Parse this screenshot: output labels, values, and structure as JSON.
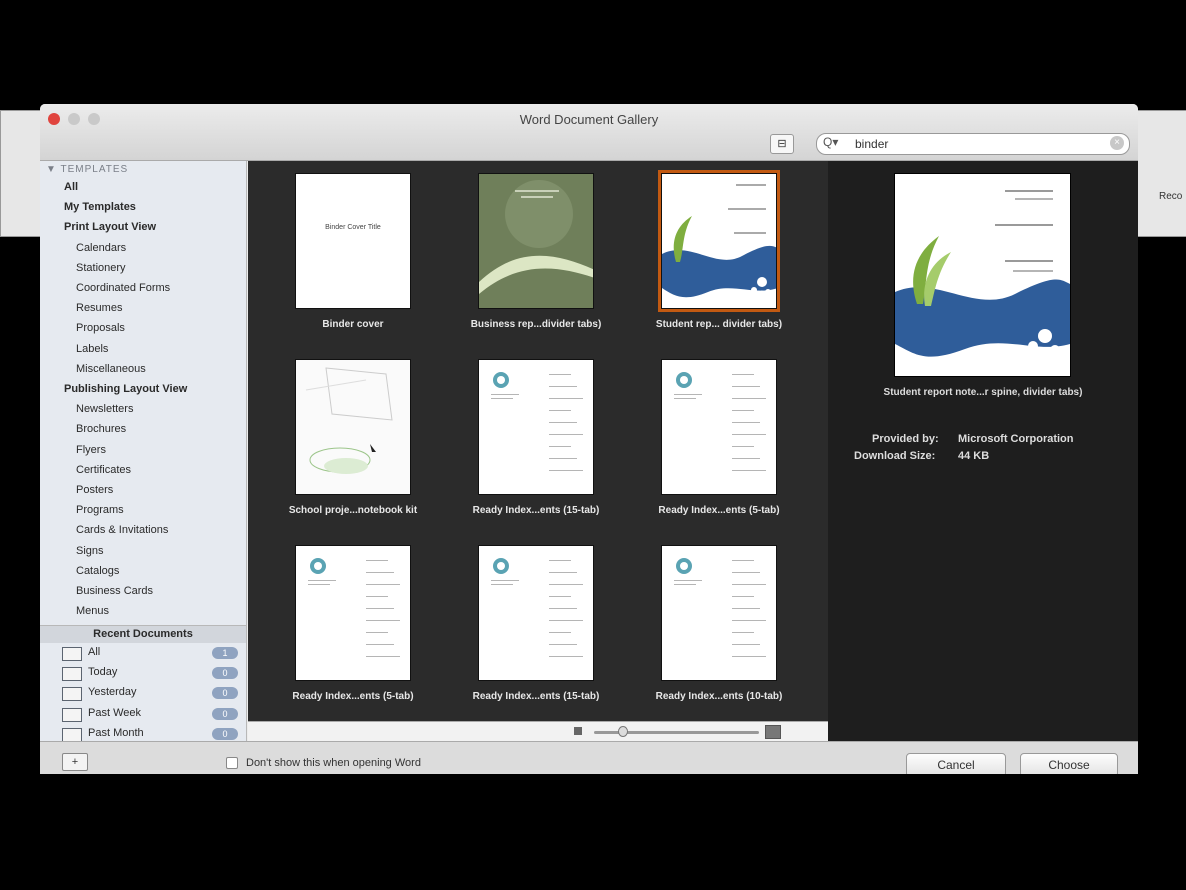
{
  "window": {
    "title": "Word Document Gallery",
    "view_button": "⊟",
    "search": {
      "icon": "search-icon",
      "menu_glyph": "Q▾",
      "value": "binder"
    }
  },
  "sidebar": {
    "section_header": "▼ TEMPLATES",
    "items": [
      {
        "label": "All",
        "level": 1
      },
      {
        "label": "My Templates",
        "level": 1
      },
      {
        "label": "Print Layout View",
        "level": 1
      },
      {
        "label": "Calendars",
        "level": 2
      },
      {
        "label": "Stationery",
        "level": 2
      },
      {
        "label": "Coordinated Forms",
        "level": 2
      },
      {
        "label": "Resumes",
        "level": 2
      },
      {
        "label": "Proposals",
        "level": 2
      },
      {
        "label": "Labels",
        "level": 2
      },
      {
        "label": "Miscellaneous",
        "level": 2
      },
      {
        "label": "Publishing Layout View",
        "level": 1
      },
      {
        "label": "Newsletters",
        "level": 2
      },
      {
        "label": "Brochures",
        "level": 2
      },
      {
        "label": "Flyers",
        "level": 2
      },
      {
        "label": "Certificates",
        "level": 2
      },
      {
        "label": "Posters",
        "level": 2
      },
      {
        "label": "Programs",
        "level": 2
      },
      {
        "label": "Cards & Invitations",
        "level": 2
      },
      {
        "label": "Signs",
        "level": 2
      },
      {
        "label": "Catalogs",
        "level": 2
      },
      {
        "label": "Business Cards",
        "level": 2
      },
      {
        "label": "Menus",
        "level": 2
      }
    ],
    "recent_header": "Recent Documents",
    "recent": [
      {
        "label": "All",
        "count": "1"
      },
      {
        "label": "Today",
        "count": "0"
      },
      {
        "label": "Yesterday",
        "count": "0"
      },
      {
        "label": "Past Week",
        "count": "0"
      },
      {
        "label": "Past Month",
        "count": "0"
      }
    ]
  },
  "templates": [
    {
      "label": "Binder cover",
      "style": "plain",
      "inner_text": "Binder Cover Title"
    },
    {
      "label": "Business rep...divider tabs)",
      "style": "green"
    },
    {
      "label": "Student rep... divider tabs)",
      "style": "wave",
      "selected": true
    },
    {
      "label": "School proje...notebook kit",
      "style": "sketch"
    },
    {
      "label": "Ready Index...ents (15-tab)",
      "style": "index"
    },
    {
      "label": "Ready Index...ents (5-tab)",
      "style": "index"
    },
    {
      "label": "Ready Index...ents (5-tab)",
      "style": "index"
    },
    {
      "label": "Ready Index...ents (15-tab)",
      "style": "index"
    },
    {
      "label": "Ready Index...ents (10-tab)",
      "style": "index"
    }
  ],
  "preview": {
    "name": "Student report note...r spine, divider tabs)",
    "provided_by_label": "Provided by:",
    "provided_by": "Microsoft Corporation",
    "download_size_label": "Download Size:",
    "download_size": "44 KB"
  },
  "footer": {
    "checkbox_label": "Don't show this when opening Word",
    "cancel": "Cancel",
    "choose": "Choose"
  },
  "background": {
    "right_caption": "Reco"
  },
  "colors": {
    "selection": "#c35a12",
    "wave_blue": "#2f5d9a",
    "leaf_green": "#7fae3f",
    "sidebar_bg": "#e6eaf0",
    "grid_bg": "#2b2b2b"
  }
}
